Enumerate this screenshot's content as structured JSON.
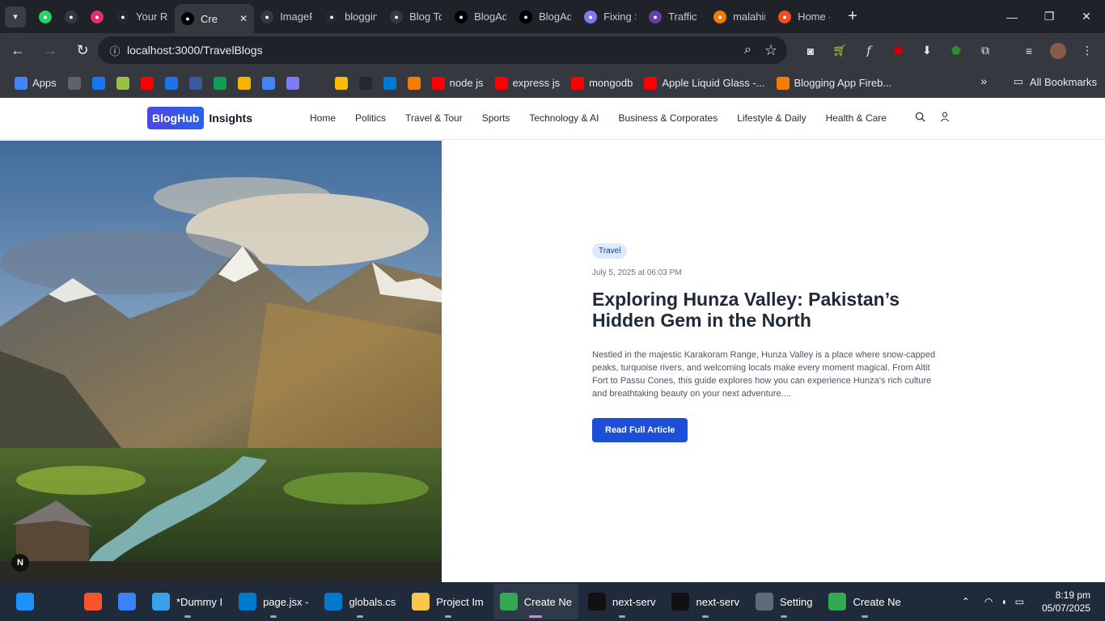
{
  "browser": {
    "tabs": [
      {
        "title": "",
        "icon": "whatsapp-icon",
        "color": "#25d366"
      },
      {
        "title": "",
        "icon": "speaker-icon",
        "color": "#35393f"
      },
      {
        "title": "",
        "icon": "instagram-icon",
        "color": "#e1306c"
      },
      {
        "title": "Your Re",
        "icon": "github-icon",
        "color": "#24292e"
      },
      {
        "title": "Cre",
        "icon": "triangle-icon",
        "color": "#000000",
        "active": true
      },
      {
        "title": "ImageF",
        "icon": "flask-icon",
        "color": "#35393f"
      },
      {
        "title": "bloggin",
        "icon": "github-icon",
        "color": "#24292e"
      },
      {
        "title": "Blog To",
        "icon": "openai-icon",
        "color": "#35393f"
      },
      {
        "title": "BlogAd",
        "icon": "triangle-icon",
        "color": "#000000"
      },
      {
        "title": "BlogAd",
        "icon": "triangle-icon",
        "color": "#000000"
      },
      {
        "title": "Fixing S",
        "icon": "vscode-icon",
        "color": "#7c7cf0"
      },
      {
        "title": "Traffic R",
        "icon": "twitch-icon",
        "color": "#6441a5"
      },
      {
        "title": "malahin",
        "icon": "firebase-icon",
        "color": "#f57c00"
      },
      {
        "title": "Home -",
        "icon": "figma-icon",
        "color": "#f24e1e"
      }
    ],
    "url": "localhost:3000/TravelBlogs",
    "bookmarks": [
      {
        "label": "Apps",
        "icon": "apps-grid-icon",
        "color": "#4285f4"
      },
      {
        "label": "",
        "icon": "grid-icon",
        "color": "#5f6368"
      },
      {
        "label": "",
        "icon": "facebook-icon",
        "color": "#1877f2"
      },
      {
        "label": "",
        "icon": "shopify-icon",
        "color": "#95bf47"
      },
      {
        "label": "",
        "icon": "youtube-icon",
        "color": "#ff0000"
      },
      {
        "label": "",
        "icon": "wifi-icon",
        "color": "#1a73e8"
      },
      {
        "label": "",
        "icon": "bottle-icon",
        "color": "#3b5998"
      },
      {
        "label": "",
        "icon": "sheets-icon",
        "color": "#0f9d58"
      },
      {
        "label": "",
        "icon": "slides-icon",
        "color": "#f4b400"
      },
      {
        "label": "",
        "icon": "image-icon",
        "color": "#4285f4"
      },
      {
        "label": "",
        "icon": "vscode-icon",
        "color": "#7c7cf0"
      },
      {
        "label": "",
        "icon": "openai-icon",
        "color": "#35393f"
      },
      {
        "label": "",
        "icon": "keep-icon",
        "color": "#fbbc04"
      },
      {
        "label": "",
        "icon": "github-icon",
        "color": "#24292e"
      },
      {
        "label": "",
        "icon": "edge-icon",
        "color": "#0078d7"
      },
      {
        "label": "",
        "icon": "firebase-icon",
        "color": "#f57c00"
      },
      {
        "label": "node js",
        "icon": "youtube-icon",
        "color": "#ff0000"
      },
      {
        "label": "express js",
        "icon": "youtube-icon",
        "color": "#ff0000"
      },
      {
        "label": "mongodb",
        "icon": "youtube-icon",
        "color": "#ff0000"
      },
      {
        "label": "Apple Liquid Glass -...",
        "icon": "youtube-icon",
        "color": "#ff0000"
      },
      {
        "label": "Blogging App Fireb...",
        "icon": "firebase-icon",
        "color": "#f57c00"
      }
    ],
    "all_bookmarks": "All Bookmarks"
  },
  "site": {
    "logo_box": "BlogHub",
    "logo_text": "Insights",
    "nav": [
      "Home",
      "Politics",
      "Travel & Tour",
      "Sports",
      "Technology & AI",
      "Business & Corporates",
      "Lifestyle & Daily",
      "Health & Care"
    ],
    "article": {
      "tag": "Travel",
      "date": "July 5, 2025 at 06:03 PM",
      "title": "Exploring Hunza Valley: Pakistan’s Hidden Gem in the North",
      "excerpt": "Nestled in the majestic Karakoram Range, Hunza Valley is a place where snow-capped peaks, turquoise rivers, and welcoming locals make every moment magical. From Altit Fort to Passu Cones, this guide explores how you can experience Hunza’s rich culture and breathtaking beauty on your next adventure....",
      "button": "Read Full Article"
    },
    "next_badge": "N"
  },
  "taskbar": {
    "items": [
      {
        "label": "",
        "icon": "windows-start-icon",
        "color": "#1e90ff"
      },
      {
        "label": "",
        "icon": "search-icon",
        "color": "#1f2a3a"
      },
      {
        "label": "",
        "icon": "brave-icon",
        "color": "#fb542b"
      },
      {
        "label": "",
        "icon": "app-store-icon",
        "color": "#3b82f6"
      },
      {
        "label": "*Dummy I",
        "icon": "notepad-icon",
        "color": "#3aa0e8"
      },
      {
        "label": "page.jsx -",
        "icon": "vscode-icon",
        "color": "#007acc"
      },
      {
        "label": "globals.cs",
        "icon": "vscode-icon",
        "color": "#007acc"
      },
      {
        "label": "Project Im",
        "icon": "folder-icon",
        "color": "#f8c846"
      },
      {
        "label": "Create Ne",
        "icon": "chrome-icon",
        "color": "#34a853",
        "active": true
      },
      {
        "label": "next-serv",
        "icon": "terminal-icon",
        "color": "#111111"
      },
      {
        "label": "next-serv",
        "icon": "terminal-icon",
        "color": "#111111"
      },
      {
        "label": "Setting",
        "icon": "settings-gear-icon",
        "color": "#5f6b7a"
      },
      {
        "label": "Create Ne",
        "icon": "chrome-icon",
        "color": "#34a853"
      }
    ],
    "time": "8:19 pm",
    "date": "05/07/2025"
  }
}
